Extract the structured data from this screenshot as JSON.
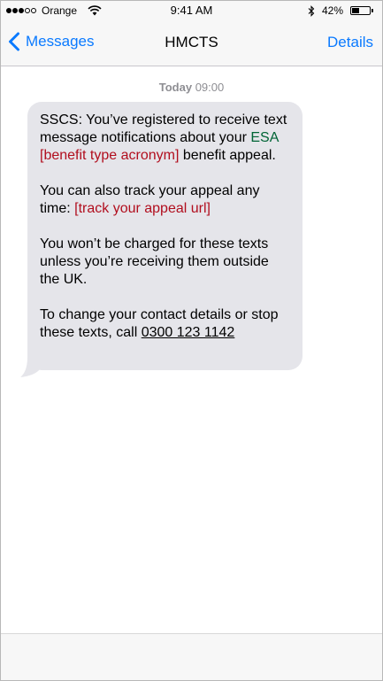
{
  "status_bar": {
    "signal_bars_filled": 3,
    "signal_bars_total": 5,
    "carrier": "Orange",
    "time": "9:41 AM",
    "battery_percent": "42%",
    "battery_level": 0.42
  },
  "nav": {
    "back_label": "Messages",
    "title": "HMCTS",
    "details_label": "Details"
  },
  "conversation": {
    "timestamp_day": "Today",
    "timestamp_time": "09:00"
  },
  "message": {
    "p1_a": "SSCS: You’ve registered to receive text message notifications about your ",
    "p1_benefit": "ESA",
    "p1_placeholder": "[benefit type acronym]",
    "p1_b": " benefit appeal.",
    "p2_a": "You can also track your appeal any time: ",
    "p2_placeholder": "[track your appeal url]",
    "p3": "You won’t be charged for these texts unless you’re receiving them outside the UK.",
    "p4_a": "To change your contact details or stop these texts, call ",
    "p4_phone": "0300 123 1142"
  },
  "colors": {
    "accent": "#0a7aff",
    "bubble": "#e5e5ea",
    "benefit_green": "#006435",
    "placeholder_red": "#b10e1e"
  }
}
